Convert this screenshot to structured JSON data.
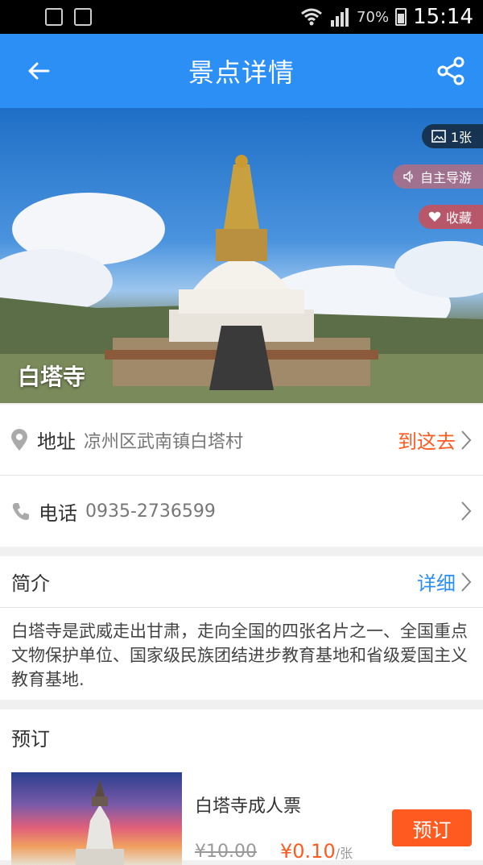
{
  "status_bar": {
    "battery": "70%",
    "time": "15:14"
  },
  "header": {
    "title": "景点详情"
  },
  "hero": {
    "name": "白塔寺",
    "photos_label": "1张",
    "guide_label": "自主导游",
    "favorite_label": "收藏"
  },
  "address": {
    "label": "地址",
    "value": "凉州区武南镇白塔村",
    "action": "到这去"
  },
  "phone": {
    "label": "电话",
    "value": "0935-2736599"
  },
  "intro": {
    "title": "简介",
    "action": "详细",
    "text": "白塔寺是武威走出甘肃，走向全国的四张名片之一、全国重点文物保护单位、国家级民族团结进步教育基地和省级爱国主义教育基地."
  },
  "booking": {
    "title": "预订",
    "ticket": {
      "name": "白塔寺成人票",
      "original_price": "¥10.00",
      "price": "¥0.10",
      "unit": "/张",
      "button": "预订"
    }
  },
  "colors": {
    "primary": "#2b8ff6",
    "accent": "#ff5a1f"
  }
}
